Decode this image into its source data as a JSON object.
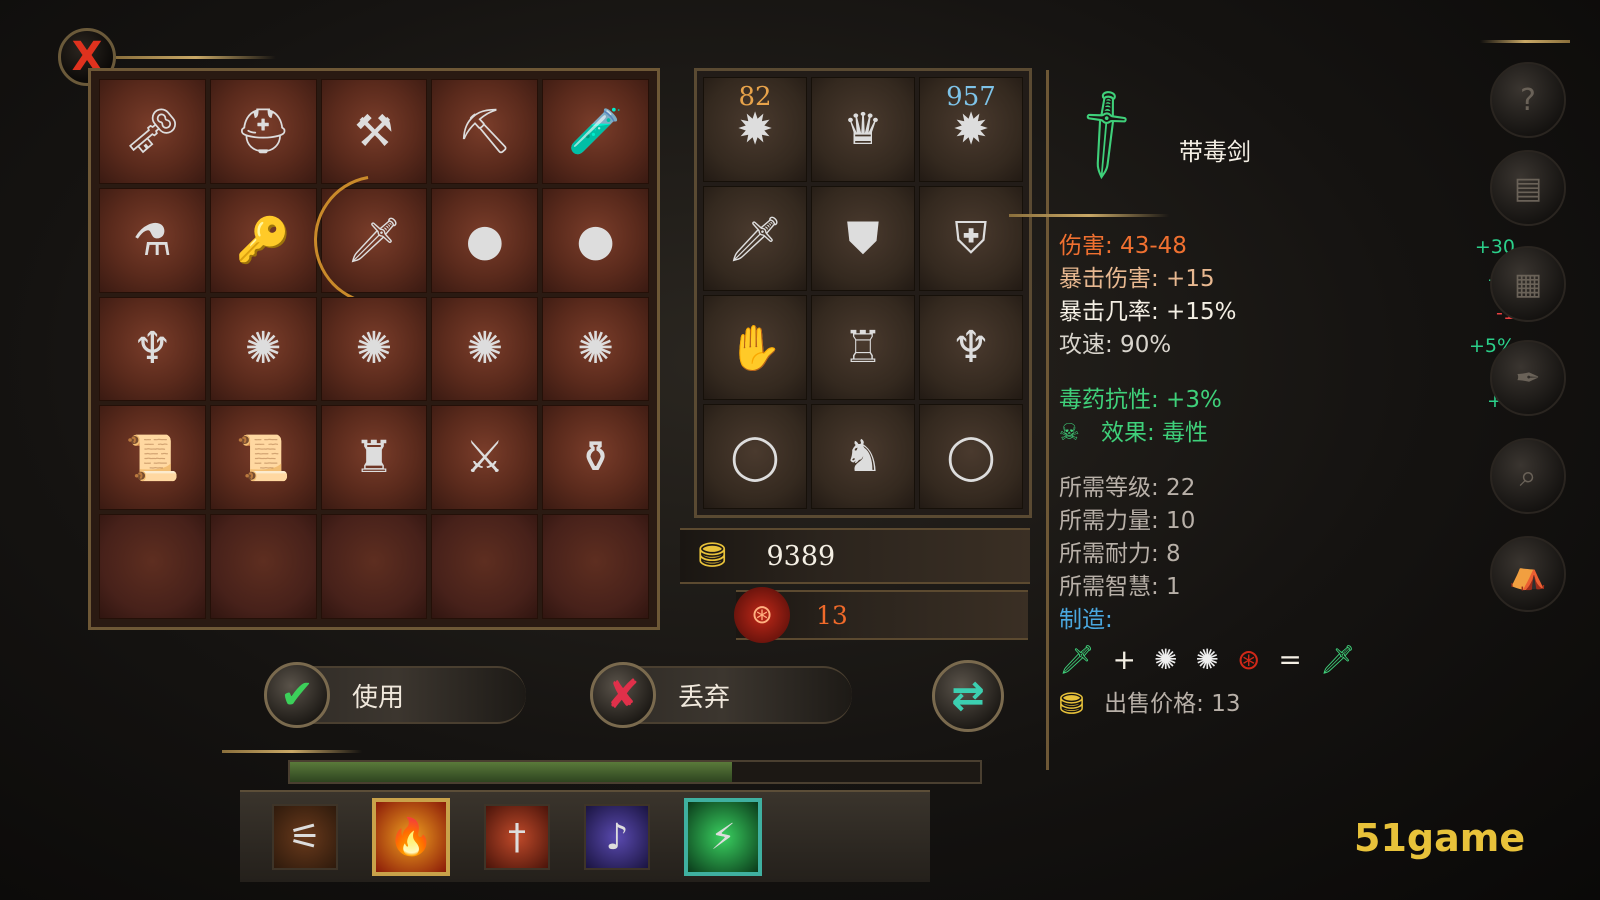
{
  "close_label": "X",
  "inventory": {
    "slots": [
      {
        "icon": "key-icon",
        "glyph": "🗝"
      },
      {
        "icon": "armor-helmet-icon",
        "glyph": "⛑"
      },
      {
        "icon": "shovel-icon",
        "glyph": "⚒"
      },
      {
        "icon": "pickaxe-icon",
        "glyph": "⛏"
      },
      {
        "icon": "vial-icon",
        "glyph": "🧪"
      },
      {
        "icon": "red-potion-icon",
        "glyph": "⚗"
      },
      {
        "icon": "ornate-key-icon",
        "glyph": "🔑"
      },
      {
        "icon": "poison-sword-icon",
        "glyph": "🗡",
        "selected": true
      },
      {
        "icon": "red-orbs-icon",
        "glyph": "●"
      },
      {
        "icon": "blue-orbs-icon",
        "glyph": "●"
      },
      {
        "icon": "pink-armor-icon",
        "glyph": "♆"
      },
      {
        "icon": "pink-dust-icon",
        "glyph": "✺"
      },
      {
        "icon": "pink-dust-icon",
        "glyph": "✺"
      },
      {
        "icon": "white-dust-icon",
        "glyph": "✺"
      },
      {
        "icon": "gold-dust-icon",
        "glyph": "✺"
      },
      {
        "icon": "scroll-icon",
        "glyph": "📜"
      },
      {
        "icon": "scroll-icon",
        "glyph": "📜"
      },
      {
        "icon": "dark-armor-icon",
        "glyph": "♜"
      },
      {
        "icon": "flame-sword-icon",
        "glyph": "⚔"
      },
      {
        "icon": "purple-potion-icon",
        "glyph": "⚱"
      },
      {
        "icon": "",
        "glyph": ""
      },
      {
        "icon": "",
        "glyph": ""
      },
      {
        "icon": "",
        "glyph": ""
      },
      {
        "icon": "",
        "glyph": ""
      },
      {
        "icon": "",
        "glyph": ""
      }
    ]
  },
  "equipment": {
    "slots": [
      {
        "icon": "red-orb-icon",
        "glyph": "✹",
        "count": "82"
      },
      {
        "icon": "bone-armor-icon",
        "glyph": "♛",
        "count": ""
      },
      {
        "icon": "blue-orb-icon",
        "glyph": "✹",
        "count": "957"
      },
      {
        "icon": "sword-icon",
        "glyph": "🗡",
        "count": ""
      },
      {
        "icon": "chest-armor-icon",
        "glyph": "⛊",
        "count": ""
      },
      {
        "icon": "shield-icon",
        "glyph": "⛨",
        "count": ""
      },
      {
        "icon": "glove-icon",
        "glyph": "✋",
        "count": ""
      },
      {
        "icon": "leg-armor-icon",
        "glyph": "♖",
        "count": ""
      },
      {
        "icon": "red-gauntlets-icon",
        "glyph": "♆",
        "count": ""
      },
      {
        "icon": "purple-ring-icon",
        "glyph": "◯",
        "count": ""
      },
      {
        "icon": "boots-icon",
        "glyph": "♞",
        "count": ""
      },
      {
        "icon": "green-ring-icon",
        "glyph": "◯",
        "count": ""
      }
    ]
  },
  "gold": "9389",
  "souls": "13",
  "item": {
    "name": "带毒剑",
    "damage": "伤害: 43-48",
    "crit_damage": "暴击伤害: +15",
    "crit_chance": "暴击几率: +15%",
    "attack_speed": "攻速: 90%",
    "poison_resist": "毒药抗性: +3%",
    "effect": "效果: 毒性",
    "req_level": "所需等级: 22",
    "req_strength": "所需力量: 10",
    "req_endurance": "所需耐力: 8",
    "req_wisdom": "所需智慧: 1",
    "craft_label": "制造:",
    "sell_price": "出售价格: 13",
    "bonuses": {
      "damage": "+30",
      "crit_damage": "+7",
      "crit_chance": "-1",
      "attack_speed": "+5%",
      "poison_resist": "+3"
    }
  },
  "craft": {
    "plus": "+",
    "equals": "="
  },
  "actions": {
    "use": "使用",
    "discard": "丢弃"
  },
  "watermark": "51game",
  "colors": {
    "damage": "#f07030",
    "crit": "#e8b890",
    "green": "#3fd07a",
    "bonus_green": "#2bd08a",
    "bonus_red": "#e84040",
    "requirements": "#b8b0a8",
    "watermark": "#e8c23a"
  }
}
